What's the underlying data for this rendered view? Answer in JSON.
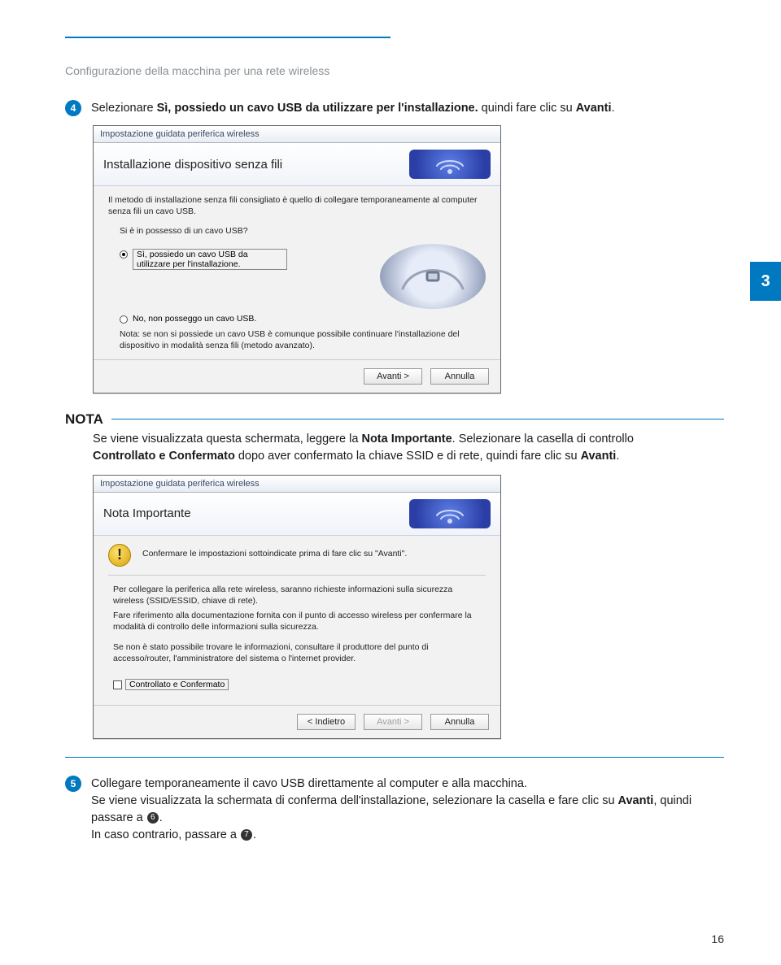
{
  "header": {
    "section_title": "Configurazione della macchina per una rete wireless",
    "chapter_tab": "3",
    "page_number": "16"
  },
  "step4": {
    "num": "4",
    "text_before": "Selezionare ",
    "bold1": "Sì, possiedo un cavo USB da utilizzare per l'installazione.",
    "mid": " quindi fare clic su ",
    "bold2": "Avanti",
    "after": "."
  },
  "wizard1": {
    "titlebar": "Impostazione guidata periferica wireless",
    "title": "Installazione dispositivo senza fili",
    "intro": "Il metodo di installazione senza fili consigliato è quello di collegare temporaneamente al computer senza fili un cavo USB.",
    "question": "Si è in possesso di un cavo USB?",
    "opt_yes": "Sì, possiedo un cavo USB da utilizzare per l'installazione.",
    "opt_no": "No, non posseggo un cavo USB.",
    "note": "Nota: se non si possiede un cavo USB è comunque possibile continuare l'installazione del dispositivo in modalità senza fili (metodo avanzato).",
    "btn_next": "Avanti >",
    "btn_cancel": "Annulla"
  },
  "nota": {
    "label": "NOTA",
    "line1_a": "Se viene visualizzata questa schermata, leggere la ",
    "line1_b": "Nota Importante",
    "line1_c": ". Selezionare la casella di controllo ",
    "line2_a": "Controllato e Confermato",
    "line2_b": " dopo aver confermato la chiave SSID e di rete, quindi fare clic su ",
    "line2_c": "Avanti",
    "line2_d": "."
  },
  "wizard2": {
    "titlebar": "Impostazione guidata periferica wireless",
    "title": "Nota Importante",
    "confirm": "Confermare le impostazioni sottoindicate prima di fare clic su \"Avanti\".",
    "p1": "Per collegare la periferica alla rete wireless, saranno richieste informazioni sulla sicurezza wireless (SSID/ESSID, chiave di rete).",
    "p2": "Fare riferimento alla documentazione fornita con il punto di accesso wireless per confermare la modalità di controllo delle informazioni sulla sicurezza.",
    "p3": "Se non è stato possibile trovare le informazioni, consultare il produttore del punto di accesso/router, l'amministratore del sistema o l'internet provider.",
    "checkbox": "Controllato e Confermato",
    "btn_back": "< Indietro",
    "btn_next": "Avanti >",
    "btn_cancel": "Annulla"
  },
  "step5": {
    "num": "5",
    "l1": "Collegare temporaneamente il cavo USB direttamente al computer e alla macchina.",
    "l2a": "Se viene visualizzata la schermata di conferma dell'installazione, selezionare la casella e fare clic su ",
    "l2b": "Avanti",
    "l2c": ", quindi passare a ",
    "l2ref": "6",
    "l2d": ".",
    "l3a": "In caso contrario, passare a ",
    "l3ref": "7",
    "l3b": "."
  }
}
